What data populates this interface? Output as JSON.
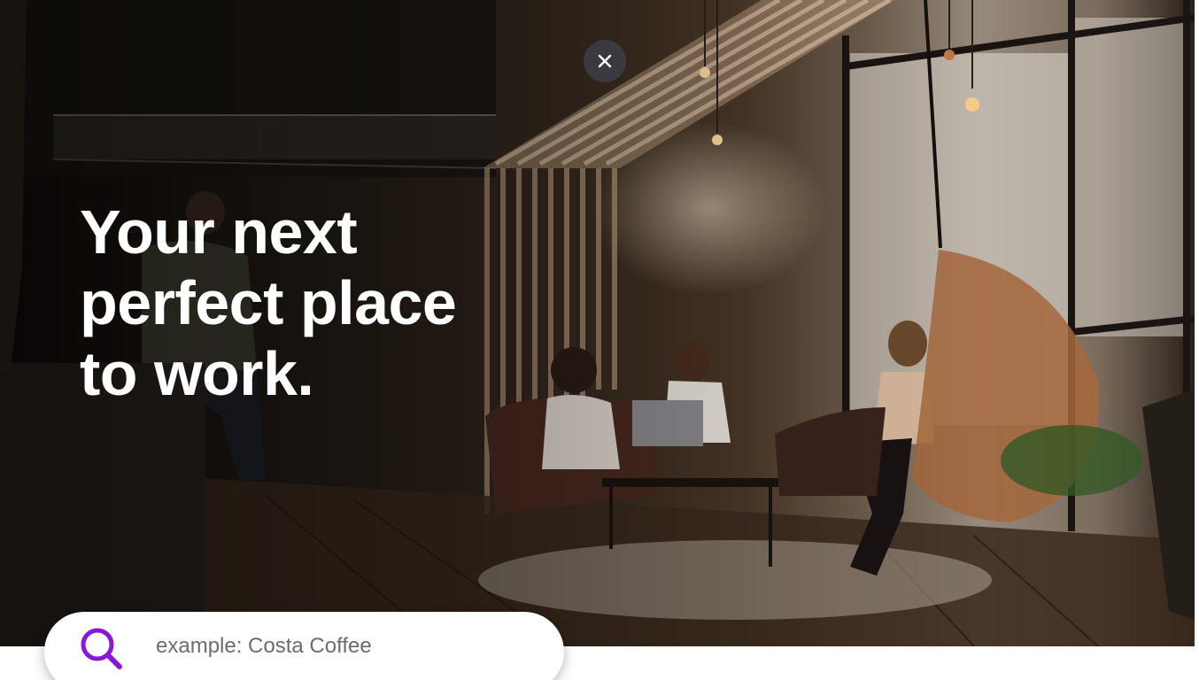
{
  "hero": {
    "headline_lines": [
      "Your next",
      "perfect place",
      "to work."
    ]
  },
  "close_button": {
    "icon": "close-icon"
  },
  "search": {
    "icon": "search-icon",
    "placeholder": "example: Costa Coffee",
    "value": "",
    "accent_color": "#8a16d8"
  }
}
